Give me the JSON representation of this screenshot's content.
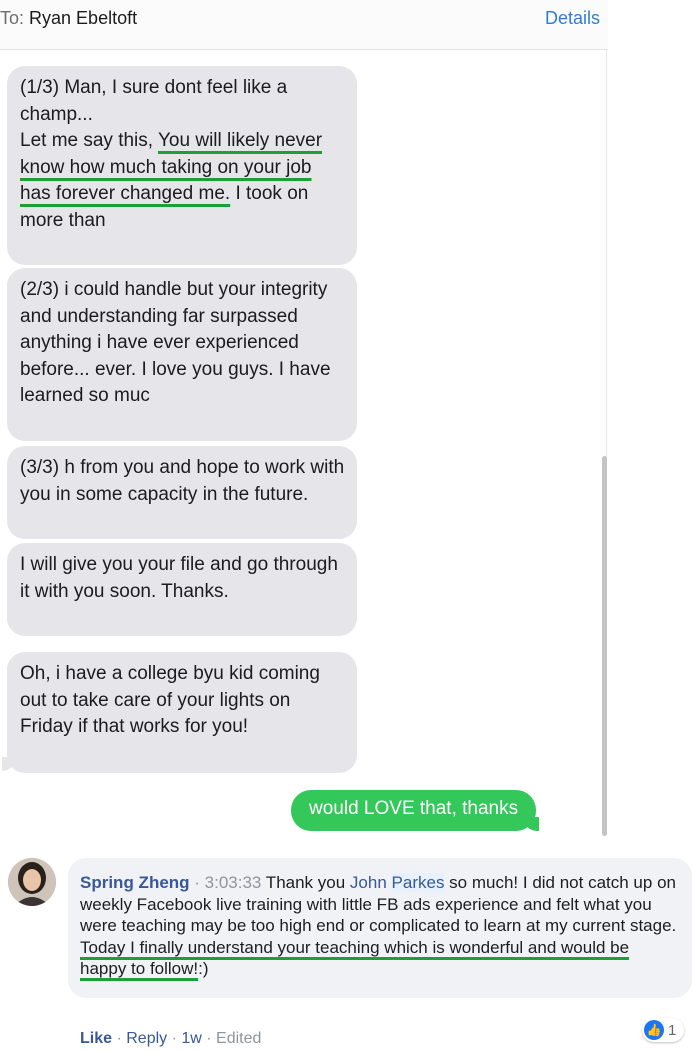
{
  "header": {
    "to_label": "To:",
    "recipient": "Ryan Ebeltoft",
    "details": "Details"
  },
  "messages": [
    {
      "segments": [
        {
          "t": "(1/3) Man, I sure dont feel like a champ...\nLet me say this, ",
          "u": false
        },
        {
          "t": "You will likely never know how much taking on your job has forever changed me.",
          "u": true
        },
        {
          "t": " I took on more than",
          "u": false
        }
      ]
    },
    {
      "segments": [
        {
          "t": "(2/3)  i could handle but your integrity and understanding far surpassed anything i have ever experienced before... ever. I love you guys. I have learned so muc",
          "u": false
        }
      ]
    },
    {
      "segments": [
        {
          "t": "(3/3) h from you and hope to work with you in some capacity in the future.",
          "u": false
        }
      ]
    },
    {
      "segments": [
        {
          "t": "I will give you your file and go through it with you soon. Thanks.",
          "u": false
        }
      ]
    },
    {
      "segments": [
        {
          "t": "Oh, i have a college byu kid coming out to take care of your lights on Friday if that works for you!",
          "u": false
        }
      ]
    }
  ],
  "outgoing": "would LOVE that, thanks",
  "comment": {
    "author": "Spring Zheng",
    "separator": " · ",
    "time": "3:03:33",
    "text_before": " Thank you ",
    "tag_first": "John",
    "tag_last": "Parkes",
    "text_middle": " so much! I did not catch up on weekly Facebook live training with little FB ads experience and felt what you were teaching may be too high end or complicated to learn at my current stage. ",
    "underlined": "Today I finally understand your teaching which is wonderful and would be happy to follow!",
    "text_after": ":)",
    "reaction_icon": "like-icon",
    "reaction_count": "1",
    "actions": {
      "like": "Like",
      "reply": "Reply",
      "age": "1w",
      "edited": "Edited",
      "dot": " · "
    }
  },
  "colors": {
    "incoming_bubble": "#e5e5ea",
    "outgoing_bubble": "#34c759",
    "underline": "#1e9e35",
    "fb_link": "#385898",
    "details_link": "#2f7dd6"
  }
}
